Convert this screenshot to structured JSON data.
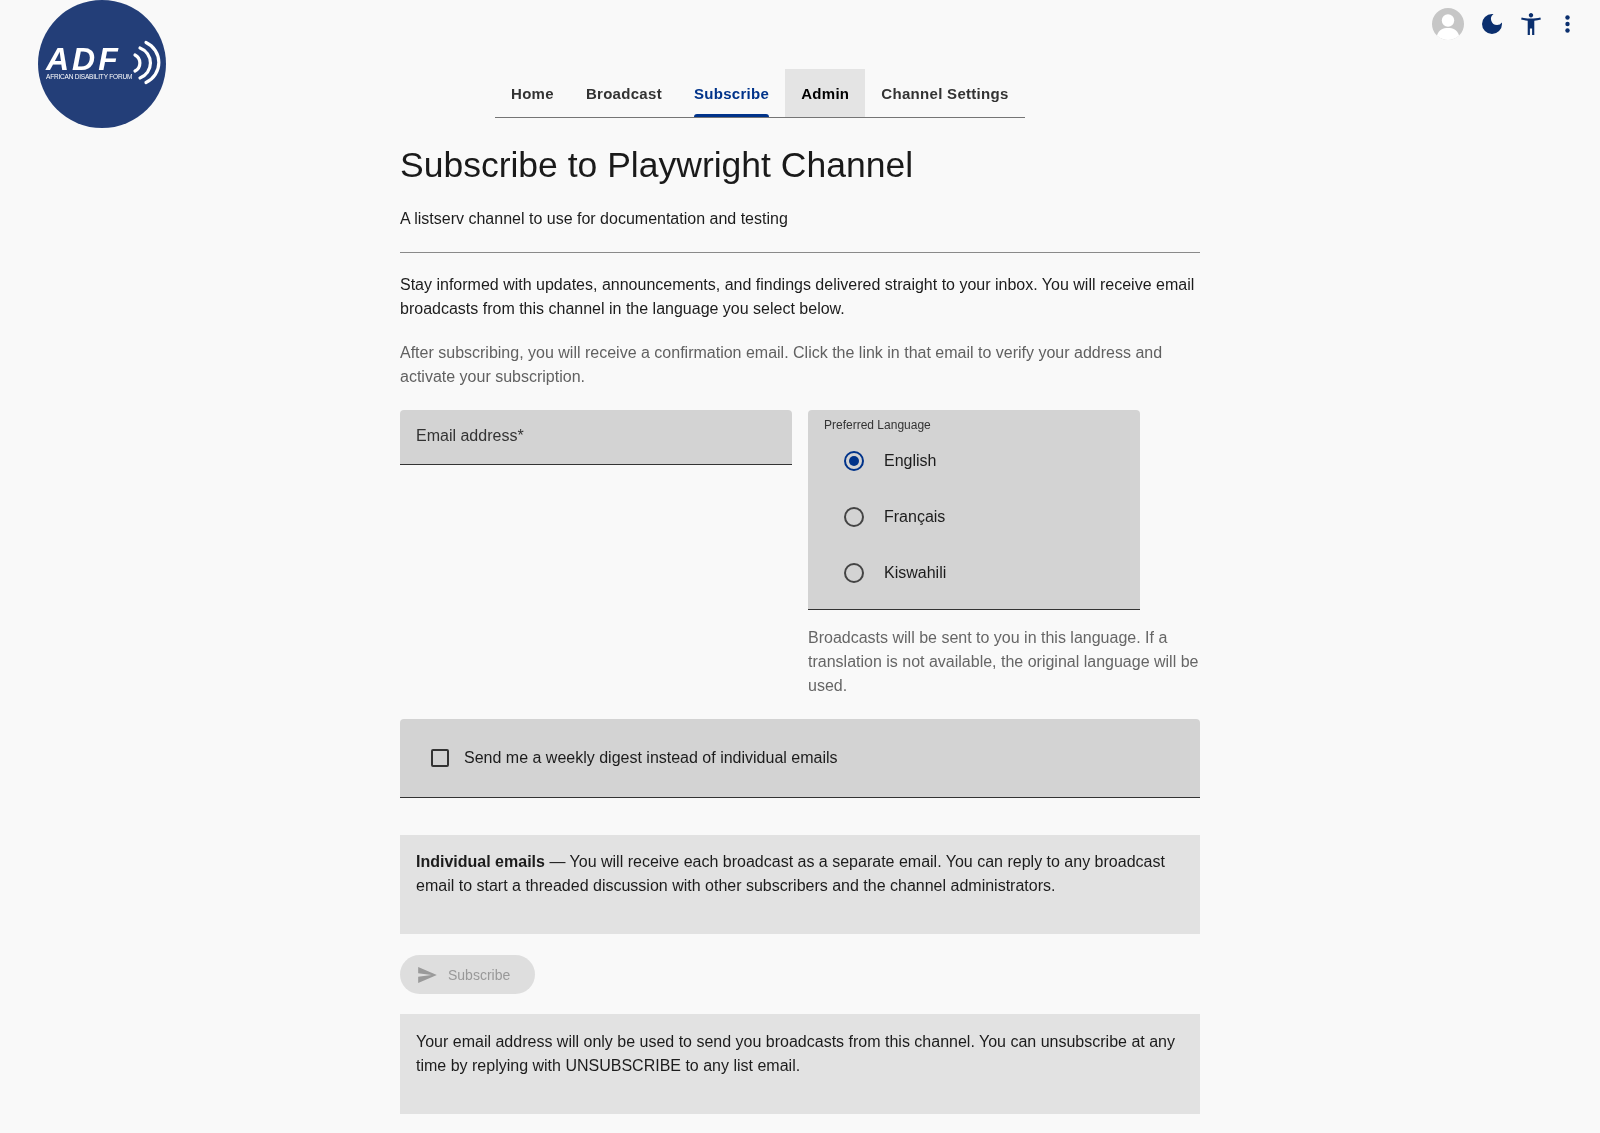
{
  "logo": {
    "wordmark": "ADF",
    "tagline": "AFRICAN DISABILITY FORUM"
  },
  "tabs": [
    {
      "label": "Home",
      "selected": false,
      "hovered": false
    },
    {
      "label": "Broadcast",
      "selected": false,
      "hovered": false
    },
    {
      "label": "Subscribe",
      "selected": true,
      "hovered": false
    },
    {
      "label": "Admin",
      "selected": false,
      "hovered": true
    },
    {
      "label": "Channel Settings",
      "selected": false,
      "hovered": false
    }
  ],
  "page": {
    "title": "Subscribe to Playwright Channel",
    "subtitle": "A listserv channel to use for documentation and testing",
    "intro": "Stay informed with updates, announcements, and findings delivered straight to your inbox. You will receive email broadcasts from this channel in the language you select below.",
    "note": "After subscribing, you will receive a confirmation email. Click the link in that email to verify your address and activate your subscription."
  },
  "form": {
    "email": {
      "placeholder": "Email address*"
    },
    "language": {
      "label": "Preferred Language",
      "options": [
        {
          "label": "English",
          "selected": true
        },
        {
          "label": "Français",
          "selected": false
        },
        {
          "label": "Kiswahili",
          "selected": false
        }
      ],
      "helper": "Broadcasts will be sent to you in this language. If a translation is not available, the original language will be used."
    },
    "digest": {
      "label": "Send me a weekly digest instead of individual emails",
      "checked": false
    },
    "mode_info": "**Individual emails** — You will receive each broadcast as a separate email. You can reply to any broadcast email to start a threaded discussion with other subscribers and the channel administrators.",
    "submit": {
      "label": "Subscribe",
      "disabled": true
    },
    "privacy_note": "Your email address will only be used to send you broadcasts from this channel. You can unsubscribe at any time by replying with UNSUBSCRIBE to any list email."
  }
}
